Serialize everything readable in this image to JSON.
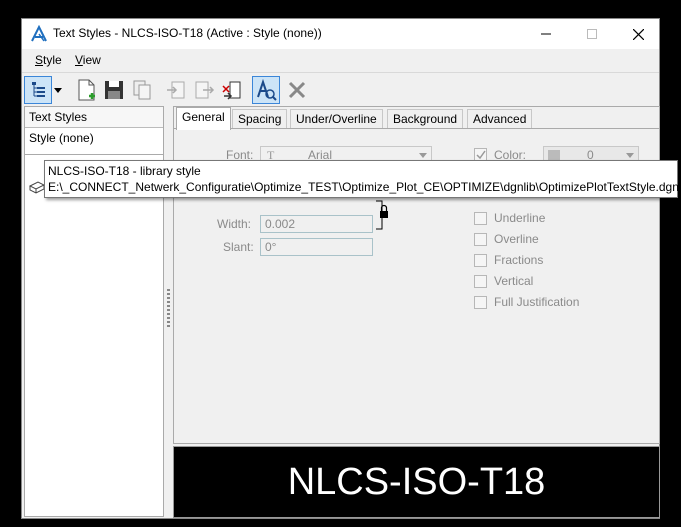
{
  "window": {
    "title": "Text Styles - NLCS-ISO-T18 (Active : Style (none))"
  },
  "menu": {
    "style_pre": "",
    "style_ul": "S",
    "style_post": "tyle",
    "view_pre": "V",
    "view_ul": "",
    "view_post": "iew"
  },
  "left_panel": {
    "header": "Text Styles",
    "none_item": "Style (none)"
  },
  "tabs": [
    "General",
    "Spacing",
    "Under/Overline",
    "Background",
    "Advanced"
  ],
  "general": {
    "font_label": "Font:",
    "font_value": "Arial",
    "color_label": "Color:",
    "color_value": "0",
    "width_label": "Width:",
    "width_value": "0.002",
    "slant_label": "Slant:",
    "slant_value": "0°",
    "checkboxes": [
      "Underline",
      "Overline",
      "Fractions",
      "Vertical",
      "Full Justification"
    ]
  },
  "tooltip": {
    "line1": "NLCS-ISO-T18 - library style",
    "line2": "E:\\_CONNECT_Netwerk_Configuratie\\Optimize_TEST\\Optimize_Plot_CE\\OPTIMIZE\\dgnlib\\OptimizePlotTextStyle.dgnlib"
  },
  "preview": {
    "text": "NLCS-ISO-T18"
  },
  "colors": {
    "accent": "#3b86d8",
    "active_button_bg": "#cce4f7"
  },
  "icons": {
    "app": "microstation-icon",
    "minimize": "minimize-icon",
    "maximize": "maximize-icon",
    "close": "close-icon"
  }
}
